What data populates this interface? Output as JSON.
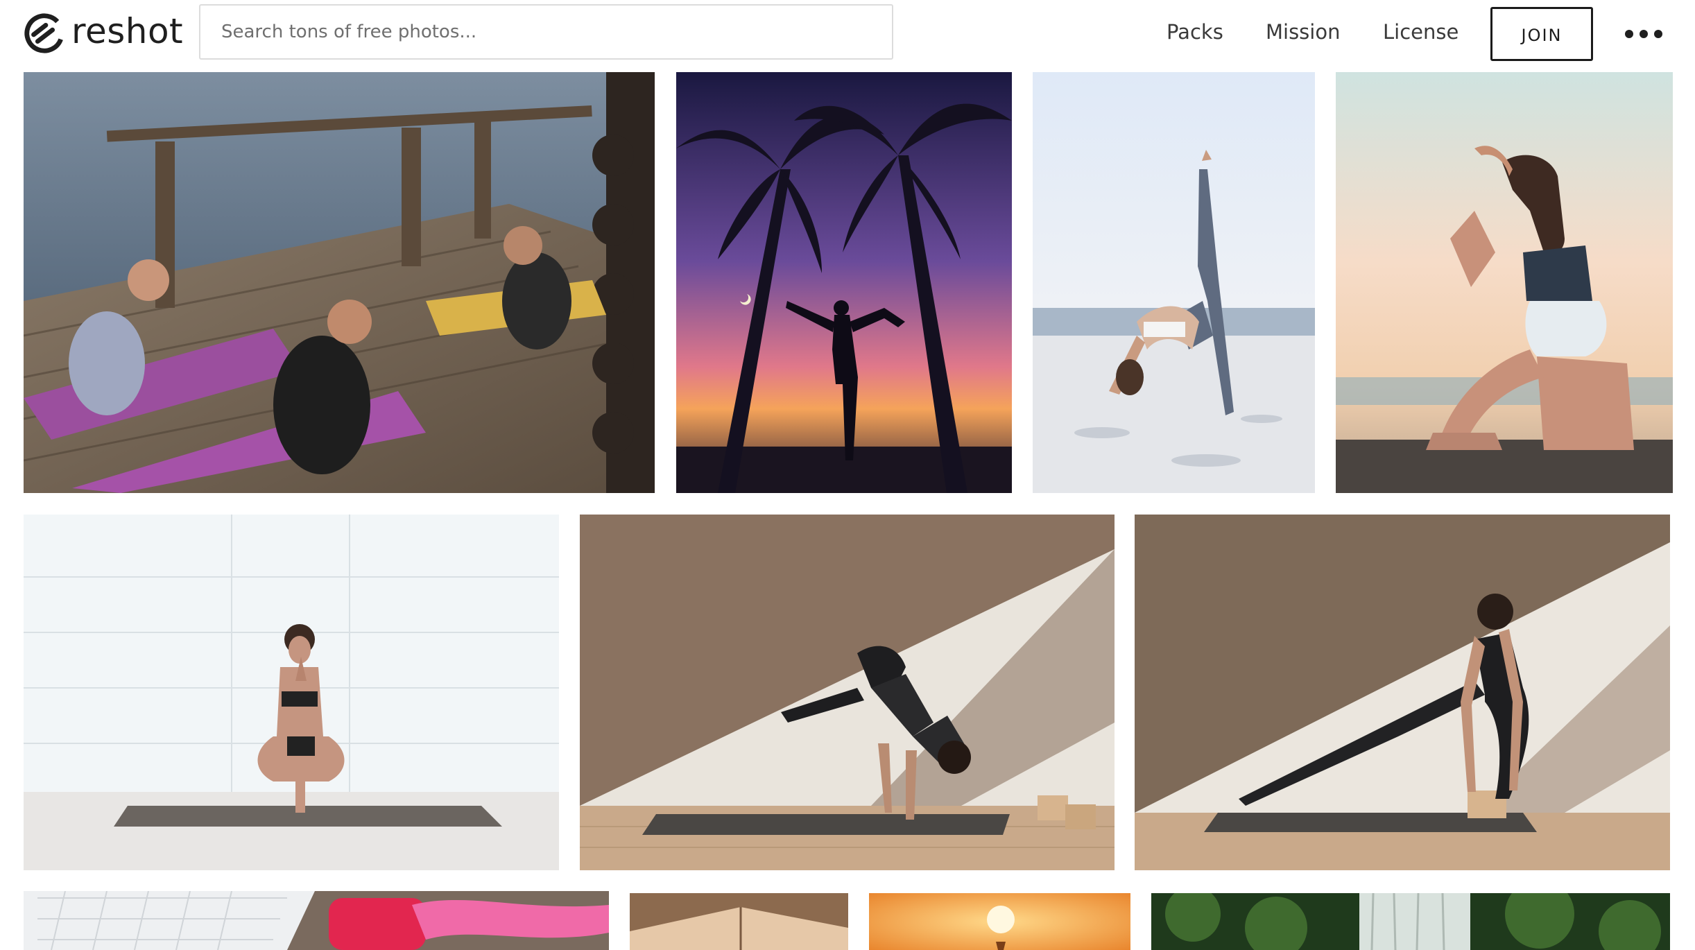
{
  "header": {
    "logo": {
      "brand": "reshot",
      "icon": "reshot-logo-icon"
    },
    "search": {
      "placeholder": "Search tons of free photos..."
    },
    "nav": [
      {
        "label": "Packs"
      },
      {
        "label": "Mission"
      },
      {
        "label": "License"
      }
    ],
    "join_label": "JOIN",
    "more_icon": "ellipsis-icon"
  },
  "photos": [
    {
      "row": 1,
      "subject": "group-stretch-deck"
    },
    {
      "row": 1,
      "subject": "palm-silhouette-sunset"
    },
    {
      "row": 1,
      "subject": "beach-wheel-split"
    },
    {
      "row": 1,
      "subject": "seaside-pigeon-pose"
    },
    {
      "row": 2,
      "subject": "toe-balance-prayer"
    },
    {
      "row": 2,
      "subject": "crow-pose-studio"
    },
    {
      "row": 2,
      "subject": "lunge-with-blocks"
    },
    {
      "row": 3,
      "subject": "laptop-dumbbell-band"
    },
    {
      "row": 3,
      "subject": "wooden-ceiling"
    },
    {
      "row": 3,
      "subject": "orange-sun"
    },
    {
      "row": 3,
      "subject": "forest-waterfall"
    }
  ],
  "colors": {
    "text_primary": "#1f1f1f",
    "nav_text": "#3a3a3a",
    "search_border": "#dcdcdc",
    "placeholder": "#6f6f6f"
  }
}
